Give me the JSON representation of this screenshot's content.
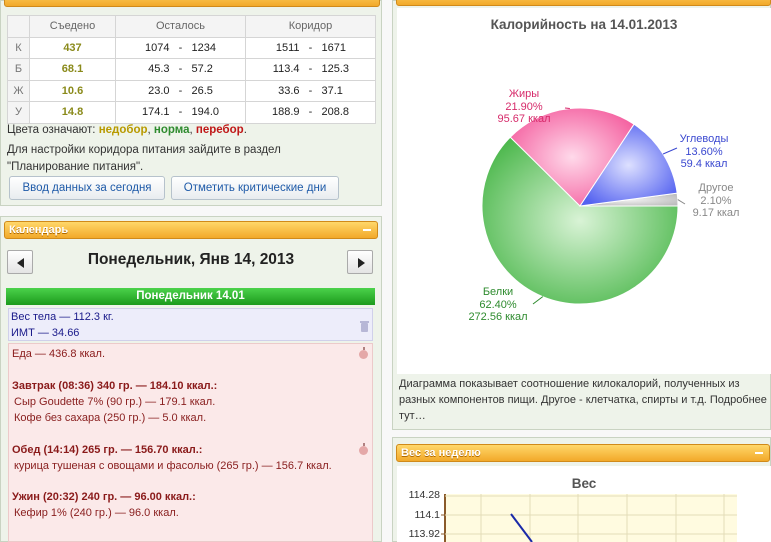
{
  "nutrition": {
    "headers": [
      "Съедено",
      "Осталось",
      "Коридор"
    ],
    "rows": [
      {
        "label": "К",
        "eaten": "437",
        "left_from": "1074",
        "left_to": "1234",
        "corr_from": "1511",
        "corr_to": "1671"
      },
      {
        "label": "Б",
        "eaten": "68.1",
        "left_from": "45.3",
        "left_to": "57.2",
        "corr_from": "113.4",
        "corr_to": "125.3"
      },
      {
        "label": "Ж",
        "eaten": "10.6",
        "left_from": "23.0",
        "left_to": "26.5",
        "corr_from": "33.6",
        "corr_to": "37.1"
      },
      {
        "label": "У",
        "eaten": "14.8",
        "left_from": "174.1",
        "left_to": "194.0",
        "corr_from": "188.9",
        "corr_to": "208.8"
      }
    ],
    "dash": "-",
    "legend_prefix": "Цвета означают:",
    "legend_under": "недобор",
    "legend_norm": "норма",
    "legend_over": "перебор",
    "info": "Для настройки коридора питания зайдите в раздел \"Планирование питания\".",
    "btn_today": "Ввод данных за сегодня",
    "btn_critical": "Отметить критические дни"
  },
  "calendar": {
    "header": "Календарь",
    "date": "Понедельник, Янв 14, 2013",
    "day_bar": "Понедельник 14.01",
    "weight": "Вес тела — 112.3 кг.",
    "bmi": "ИМТ — 34.66",
    "food_total": "Еда — 436.8 ккал.",
    "meals": [
      {
        "title": "Завтрак (08:36) 340 гр. — 184.10 ккал.:",
        "items": [
          "Сыр Goudette 7% (90 гр.) — 179.1 ккал.",
          "Кофе без сахара (250 гр.) — 5.0 ккал."
        ]
      },
      {
        "title": "Обед (14:14) 265 гр. — 156.70 ккал.:",
        "items": [
          "курица тушеная с овощами и фасолью (265 гр.) — 156.7 ккал."
        ]
      },
      {
        "title": "Ужин (20:32) 240 гр. — 96.00 ккал.:",
        "items": [
          "Кефир 1% (240 гр.) — 96.0 ккал."
        ]
      }
    ]
  },
  "chart_data": {
    "type": "pie",
    "title": "Калорийность на 14.01.2013",
    "slices": [
      {
        "name": "Белки",
        "percent": "62.40%",
        "kcal": "272.56 ккал",
        "value": 62.4,
        "color": "#5cc05c"
      },
      {
        "name": "Жиры",
        "percent": "21.90%",
        "kcal": "95.67 ккал",
        "value": 21.9,
        "color": "#f57cb0"
      },
      {
        "name": "Углеводы",
        "percent": "13.60%",
        "kcal": "59.4 ккал",
        "value": 13.6,
        "color": "#6b78f2"
      },
      {
        "name": "Другое",
        "percent": "2.10%",
        "kcal": "9.17 ккал",
        "value": 2.1,
        "color": "#c8c8c8"
      }
    ],
    "label_colors": {
      "Белки": "#2e8b2e",
      "Жиры": "#d62a6a",
      "Углеводы": "#3a48d0",
      "Другое": "#888888"
    }
  },
  "description": "Диаграмма показывает соотношение килокалорий, полученных из разных компонентов пищи. Другое - клетчатка, спирты и т.д. Подробнее тут…",
  "week": {
    "header": "Вес за неделю",
    "chart_title": "Вес",
    "yticks": [
      "114.28",
      "114.1",
      "113.92"
    ]
  }
}
